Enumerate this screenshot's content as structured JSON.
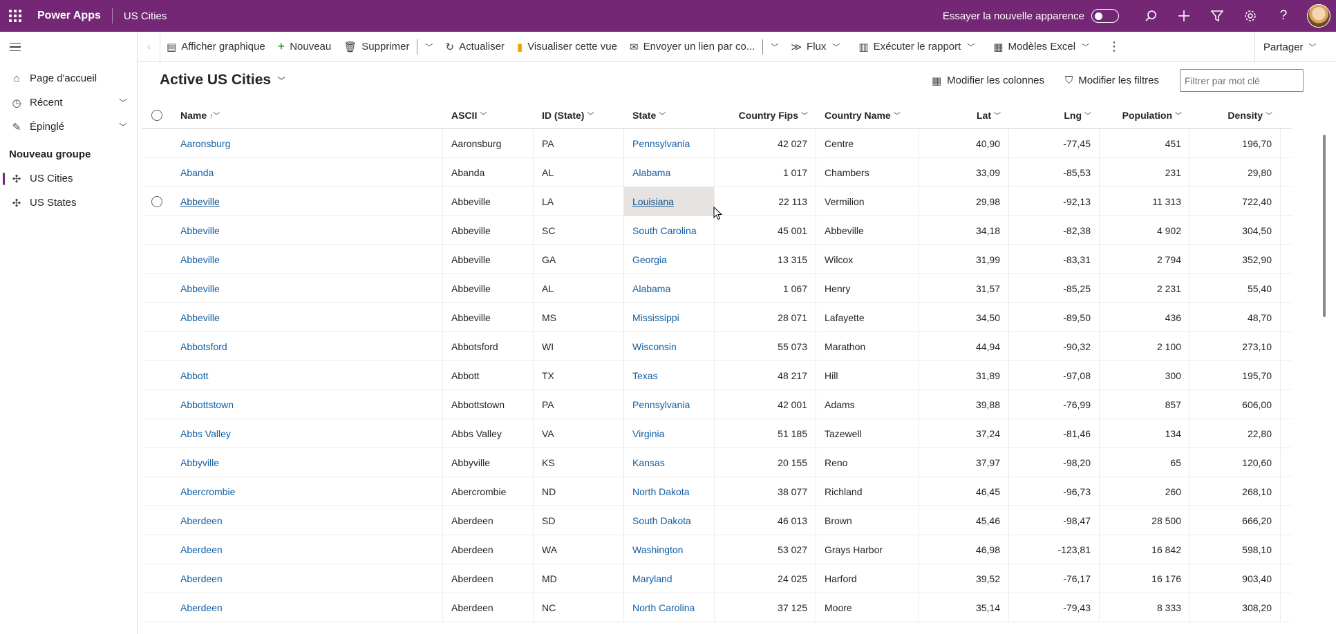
{
  "topbar": {
    "app_name": "Power Apps",
    "env_name": "US Cities",
    "try_new_look": "Essayer la nouvelle apparence",
    "icons": [
      "search-icon",
      "plus-icon",
      "filter-icon",
      "gear-icon",
      "help-icon"
    ]
  },
  "nav": {
    "home": "Page d'accueil",
    "recent": "Récent",
    "pinned": "Épinglé",
    "group_title": "Nouveau groupe",
    "items": [
      {
        "label": "US Cities",
        "active": true
      },
      {
        "label": "US States",
        "active": false
      }
    ]
  },
  "commands": {
    "show_chart": "Afficher graphique",
    "new": "Nouveau",
    "delete": "Supprimer",
    "refresh": "Actualiser",
    "visualize": "Visualiser cette vue",
    "email_link": "Envoyer un lien par co...",
    "flow": "Flux",
    "run_report": "Exécuter le rapport",
    "excel_templates": "Modèles Excel",
    "share": "Partager"
  },
  "view": {
    "title": "Active US Cities",
    "edit_columns": "Modifier les colonnes",
    "edit_filters": "Modifier les filtres",
    "filter_placeholder": "Filtrer par mot clé"
  },
  "columns": {
    "name": "Name",
    "ascii": "ASCII",
    "id_state": "ID (State)",
    "state": "State",
    "country_fips": "Country Fips",
    "country_name": "Country Name",
    "lat": "Lat",
    "lng": "Lng",
    "population": "Population",
    "density": "Density"
  },
  "rows": [
    {
      "name": "Aaronsburg",
      "ascii": "Aaronsburg",
      "id": "PA",
      "state": "Pennsylvania",
      "fips": "42 027",
      "county": "Centre",
      "lat": "40,90",
      "lng": "-77,45",
      "pop": "451",
      "den": "196,70"
    },
    {
      "name": "Abanda",
      "ascii": "Abanda",
      "id": "AL",
      "state": "Alabama",
      "fips": "1 017",
      "county": "Chambers",
      "lat": "33,09",
      "lng": "-85,53",
      "pop": "231",
      "den": "29,80"
    },
    {
      "name": "Abbeville",
      "ascii": "Abbeville",
      "id": "LA",
      "state": "Louisiana",
      "fips": "22 113",
      "county": "Vermilion",
      "lat": "29,98",
      "lng": "-92,13",
      "pop": "11 313",
      "den": "722,40"
    },
    {
      "name": "Abbeville",
      "ascii": "Abbeville",
      "id": "SC",
      "state": "South Carolina",
      "fips": "45 001",
      "county": "Abbeville",
      "lat": "34,18",
      "lng": "-82,38",
      "pop": "4 902",
      "den": "304,50"
    },
    {
      "name": "Abbeville",
      "ascii": "Abbeville",
      "id": "GA",
      "state": "Georgia",
      "fips": "13 315",
      "county": "Wilcox",
      "lat": "31,99",
      "lng": "-83,31",
      "pop": "2 794",
      "den": "352,90"
    },
    {
      "name": "Abbeville",
      "ascii": "Abbeville",
      "id": "AL",
      "state": "Alabama",
      "fips": "1 067",
      "county": "Henry",
      "lat": "31,57",
      "lng": "-85,25",
      "pop": "2 231",
      "den": "55,40"
    },
    {
      "name": "Abbeville",
      "ascii": "Abbeville",
      "id": "MS",
      "state": "Mississippi",
      "fips": "28 071",
      "county": "Lafayette",
      "lat": "34,50",
      "lng": "-89,50",
      "pop": "436",
      "den": "48,70"
    },
    {
      "name": "Abbotsford",
      "ascii": "Abbotsford",
      "id": "WI",
      "state": "Wisconsin",
      "fips": "55 073",
      "county": "Marathon",
      "lat": "44,94",
      "lng": "-90,32",
      "pop": "2 100",
      "den": "273,10"
    },
    {
      "name": "Abbott",
      "ascii": "Abbott",
      "id": "TX",
      "state": "Texas",
      "fips": "48 217",
      "county": "Hill",
      "lat": "31,89",
      "lng": "-97,08",
      "pop": "300",
      "den": "195,70"
    },
    {
      "name": "Abbottstown",
      "ascii": "Abbottstown",
      "id": "PA",
      "state": "Pennsylvania",
      "fips": "42 001",
      "county": "Adams",
      "lat": "39,88",
      "lng": "-76,99",
      "pop": "857",
      "den": "606,00"
    },
    {
      "name": "Abbs Valley",
      "ascii": "Abbs Valley",
      "id": "VA",
      "state": "Virginia",
      "fips": "51 185",
      "county": "Tazewell",
      "lat": "37,24",
      "lng": "-81,46",
      "pop": "134",
      "den": "22,80"
    },
    {
      "name": "Abbyville",
      "ascii": "Abbyville",
      "id": "KS",
      "state": "Kansas",
      "fips": "20 155",
      "county": "Reno",
      "lat": "37,97",
      "lng": "-98,20",
      "pop": "65",
      "den": "120,60"
    },
    {
      "name": "Abercrombie",
      "ascii": "Abercrombie",
      "id": "ND",
      "state": "North Dakota",
      "fips": "38 077",
      "county": "Richland",
      "lat": "46,45",
      "lng": "-96,73",
      "pop": "260",
      "den": "268,10"
    },
    {
      "name": "Aberdeen",
      "ascii": "Aberdeen",
      "id": "SD",
      "state": "South Dakota",
      "fips": "46 013",
      "county": "Brown",
      "lat": "45,46",
      "lng": "-98,47",
      "pop": "28 500",
      "den": "666,20"
    },
    {
      "name": "Aberdeen",
      "ascii": "Aberdeen",
      "id": "WA",
      "state": "Washington",
      "fips": "53 027",
      "county": "Grays Harbor",
      "lat": "46,98",
      "lng": "-123,81",
      "pop": "16 842",
      "den": "598,10"
    },
    {
      "name": "Aberdeen",
      "ascii": "Aberdeen",
      "id": "MD",
      "state": "Maryland",
      "fips": "24 025",
      "county": "Harford",
      "lat": "39,52",
      "lng": "-76,17",
      "pop": "16 176",
      "den": "903,40"
    },
    {
      "name": "Aberdeen",
      "ascii": "Aberdeen",
      "id": "NC",
      "state": "North Carolina",
      "fips": "37 125",
      "county": "Moore",
      "lat": "35,14",
      "lng": "-79,43",
      "pop": "8 333",
      "den": "308,20"
    }
  ],
  "colors": {
    "brand": "#742774",
    "link": "#115ea3"
  }
}
